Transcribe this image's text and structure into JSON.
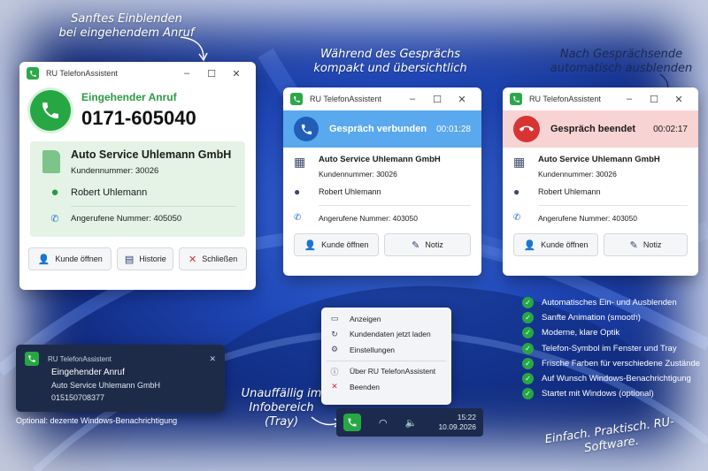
{
  "annotations": {
    "top_left": "Sanftes Einblenden\nbei eingehendem Anruf",
    "top_middle": "Während des Gesprächs\nkompakt und übersichtlich",
    "top_right": "Nach Gesprächsende\nautomatisch ausblenden",
    "tray_note": "Unauffällig im\nInfobereich (Tray)",
    "slogan": "Einfach. Praktisch. RU-Software."
  },
  "app_title": "RU TelefonAssistent",
  "incoming": {
    "heading": "Eingehender Anruf",
    "number": "0171-605040",
    "company": "Auto Service Uhlemann GmbH",
    "customer_number": "Kundennummer: 30026",
    "contact": "Robert Uhlemann",
    "called_number": "Angerufene Nummer:  405050",
    "buttons": {
      "open": "Kunde öffnen",
      "history": "Historie",
      "close": "Schließen"
    }
  },
  "connected": {
    "status": "Gespräch verbunden",
    "timer": "00:01:28",
    "company": "Auto Service Uhlemann GmbH",
    "customer_number": "Kundennummer: 30026",
    "contact": "Robert Uhlemann",
    "called_number": "Angerufene Nummer:  403050",
    "buttons": {
      "open": "Kunde öffnen",
      "note": "Notiz"
    }
  },
  "ended": {
    "status": "Gespräch beendet",
    "timer": "00:02:17",
    "company": "Auto Service Uhlemann GmbH",
    "customer_number": "Kundennummer: 30026",
    "contact": "Robert Uhlemann",
    "called_number": "Angerufene Nummer:  403050",
    "buttons": {
      "open": "Kunde öffnen",
      "note": "Notiz"
    }
  },
  "toast": {
    "title": "Eingehender Anruf",
    "company": "Auto Service Uhlemann GmbH",
    "number": "015150708377",
    "caption": "Optional: dezente Windows-Benachrichtigung"
  },
  "tray_menu": {
    "items": [
      "Anzeigen",
      "Kundendaten jetzt laden",
      "Einstellungen",
      "Über RU TelefonAssistent",
      "Beenden"
    ]
  },
  "taskbar": {
    "time": "15:22",
    "date": "10.09.2026"
  },
  "features": [
    "Automatisches Ein- und Ausblenden",
    "Sanfte Animation (smooth)",
    "Moderne, klare Optik",
    "Telefon-Symbol im Fenster und Tray",
    "Frische Farben für verschiedene Zustände",
    "Auf Wunsch Windows-Benachrichtigung",
    "Startet mit Windows (optional)"
  ],
  "colors": {
    "accent_green": "#27a744",
    "connected_blue": "#2e7ed8",
    "ended_red": "#d83434",
    "background_blue": "#1f47b8"
  }
}
